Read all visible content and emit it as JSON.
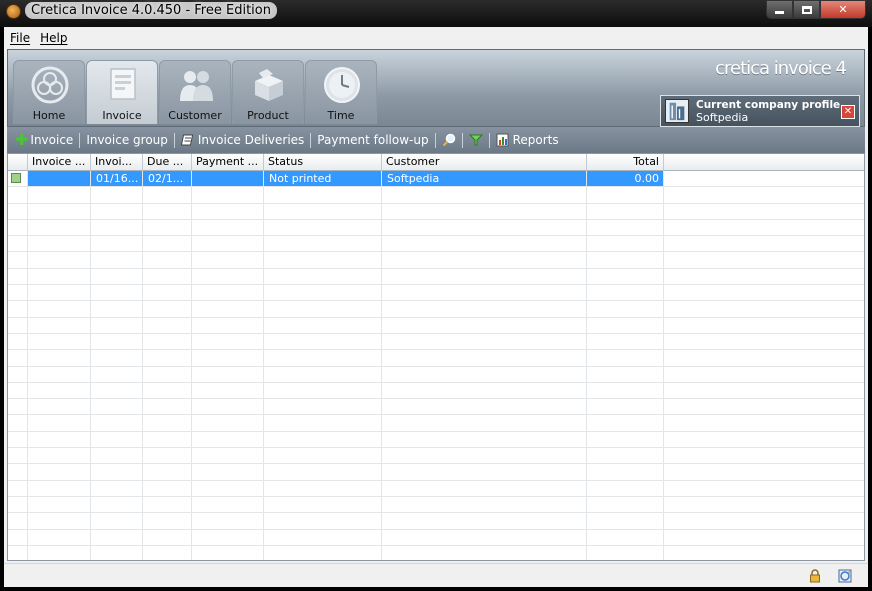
{
  "window": {
    "title": "Cretica Invoice 4.0.450 - Free Edition"
  },
  "menu": {
    "file": "File",
    "help": "Help"
  },
  "ribbon": {
    "brand": "cretica invoice 4",
    "tabs": [
      {
        "label": "Home",
        "icon": "home-icon"
      },
      {
        "label": "Invoice",
        "icon": "invoice-icon"
      },
      {
        "label": "Customer",
        "icon": "customer-icon"
      },
      {
        "label": "Product",
        "icon": "product-icon"
      },
      {
        "label": "Time",
        "icon": "clock-icon"
      }
    ],
    "active_tab": "Invoice",
    "company": {
      "title": "Current company profile",
      "name": "Softpedia"
    }
  },
  "toolbar": {
    "invoice": "Invoice",
    "invoice_group": "Invoice group",
    "invoice_deliveries": "Invoice Deliveries",
    "payment_followup": "Payment follow-up",
    "reports": "Reports"
  },
  "grid": {
    "columns": [
      "Invoice ...",
      "Invoi...",
      "Due ...",
      "Payment ...",
      "Status",
      "Customer",
      "Total"
    ],
    "rows": [
      {
        "invoice_no": "",
        "invoice_date": "01/16...",
        "due": "02/1...",
        "payment": "",
        "status": "Not printed",
        "customer": "Softpedia",
        "total": "0.00"
      }
    ]
  },
  "colors": {
    "selection": "#3399ff",
    "ribbon": "#8d9aa6",
    "accent_close": "#c3392a"
  }
}
